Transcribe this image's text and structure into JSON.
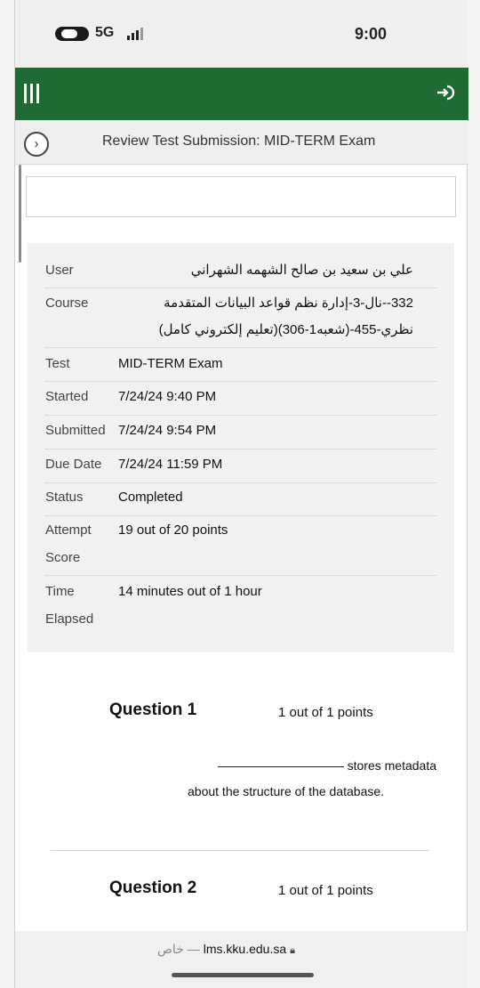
{
  "status_bar": {
    "network": "5G",
    "time": "9:00"
  },
  "page": {
    "title": "Review Test Submission: MID-TERM Exam"
  },
  "details": {
    "rows": [
      {
        "label": "User",
        "value": "علي بن سعيد بن صالح الشهمه الشهراني"
      },
      {
        "label": "Course",
        "value": "332--نال-3-إدارة نظم قواعد البيانات المتقدمة",
        "value2": "نظري-455-(شعبه1-306)(تعليم إلكتروني كامل)"
      },
      {
        "label": "Test",
        "value": "MID-TERM Exam"
      },
      {
        "label": "Started",
        "value": "7/24/24 9:40 PM"
      },
      {
        "label": "Submitted",
        "value": "7/24/24 9:54 PM"
      },
      {
        "label": "Due Date",
        "value": "7/24/24 11:59 PM"
      },
      {
        "label": "Status",
        "value": "Completed"
      },
      {
        "label": "Attempt",
        "label2": "Score",
        "value": "19 out of 20 points"
      },
      {
        "label": "Time",
        "label2": "Elapsed",
        "value": "14 minutes out of 1 hour"
      }
    ]
  },
  "questions": [
    {
      "title": "Question 1",
      "points": "1 out of 1 points",
      "text_after_blank": "stores metadata",
      "text_line2": "about the structure of the database."
    },
    {
      "title": "Question 2",
      "points": "1 out of 1 points"
    }
  ],
  "url_bar": {
    "private_label": "خاص —",
    "domain": "lms.kku.edu.sa"
  },
  "icons": [
    "battery-icon",
    "signal-bars-icon",
    "hamburger-menu-icon",
    "login-arrow-icon",
    "chevron-right-icon",
    "lock-icon"
  ]
}
